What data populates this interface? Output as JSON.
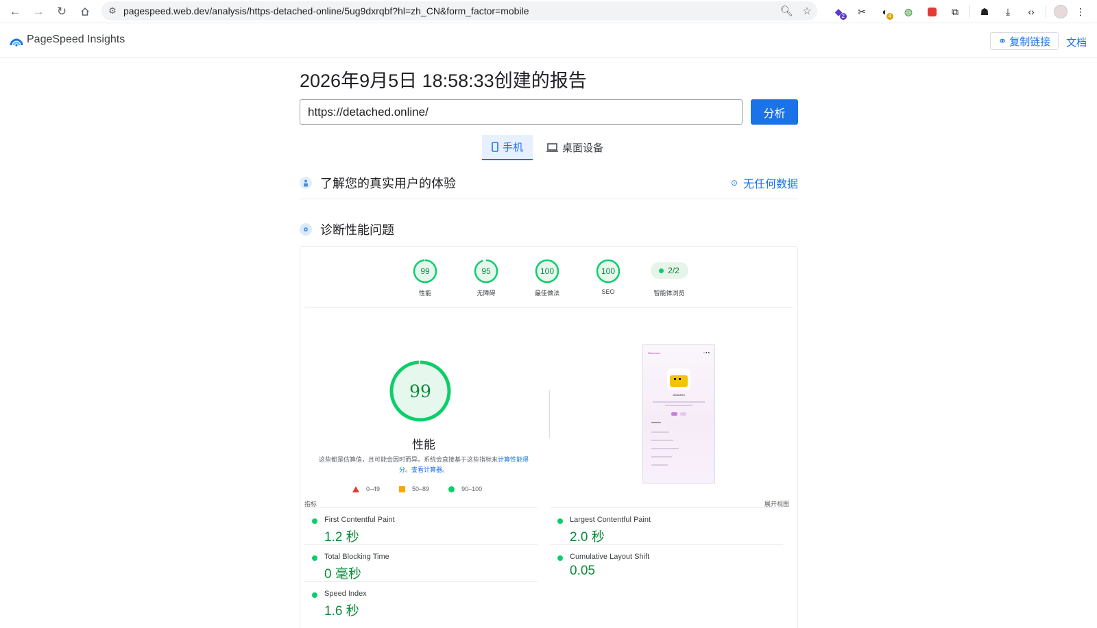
{
  "browser": {
    "url": "pagespeed.web.dev/analysis/https-detached-online/5ug9dxrqbf?hl=zh_CN&form_factor=mobile",
    "extensions": [
      {
        "icon": "purple-gem-icon",
        "badge": "2",
        "badge_color": "#5b3cc4"
      },
      {
        "icon": "scissors-icon",
        "badge": ""
      },
      {
        "icon": "circle-arrow-icon",
        "badge": "4",
        "badge_color": "#e0a000"
      },
      {
        "icon": "globe-icon",
        "badge": ""
      },
      {
        "icon": "media-icon",
        "badge": ""
      },
      {
        "icon": "puzzle-icon",
        "badge": ""
      }
    ]
  },
  "header": {
    "app_name": "PageSpeed Insights",
    "copy_link": "复制链接",
    "docs": "文档"
  },
  "report": {
    "title": "2026年9月5日 18:58:33创建的报告",
    "url_value": "https://detached.online/",
    "analyze": "分析"
  },
  "tabs": {
    "mobile": "手机",
    "desktop": "桌面设备"
  },
  "crux": {
    "title": "了解您的真实用户的体验",
    "no_data": "无任何数据"
  },
  "diagnose": {
    "title": "诊断性能问题"
  },
  "scores": [
    {
      "value": 99,
      "label": "性能"
    },
    {
      "value": 95,
      "label": "无障碍"
    },
    {
      "value": 100,
      "label": "最佳做法"
    },
    {
      "value": 100,
      "label": "SEO"
    }
  ],
  "agentic": {
    "value": "2/2",
    "label": "智能体浏览"
  },
  "performance": {
    "score": 99,
    "title": "性能",
    "desc_part1": "这些都是估算值，且可能会因时而异。系统会直接基于这些指标来",
    "desc_link1": "计算性能得分",
    "desc_part2": "。",
    "desc_link2": "查看计算器",
    "desc_part3": "。"
  },
  "legend": {
    "poor": "0–49",
    "average": "50–89",
    "good": "90–100"
  },
  "colors": {
    "good": "#0cce6b",
    "good_text": "#0c8a3a",
    "average": "#ffa400",
    "poor": "#e53935",
    "accent": "#1a73e8"
  },
  "screenshot": {
    "brand": "Detached",
    "name": "Detached"
  },
  "metrics": {
    "heading": "指标",
    "expand": "展开视图",
    "left": [
      {
        "name": "First Contentful Paint",
        "value": "1.2 秒"
      },
      {
        "name": "Total Blocking Time",
        "value": "0 毫秒"
      },
      {
        "name": "Speed Index",
        "value": "1.6 秒"
      }
    ],
    "right": [
      {
        "name": "Largest Contentful Paint",
        "value": "2.0 秒"
      },
      {
        "name": "Cumulative Layout Shift",
        "value": "0.05"
      }
    ]
  }
}
